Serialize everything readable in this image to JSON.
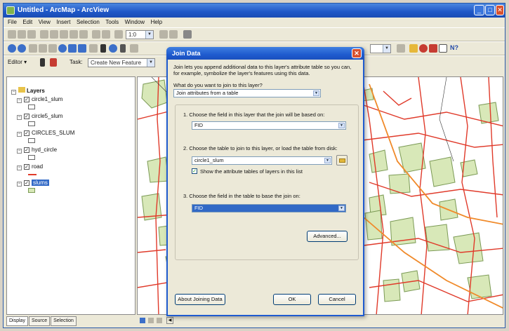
{
  "window": {
    "title": "Untitled - ArcMap - ArcView"
  },
  "menu": [
    "File",
    "Edit",
    "View",
    "Insert",
    "Selection",
    "Tools",
    "Window",
    "Help"
  ],
  "toolbar": {
    "scale_value": "1:0",
    "editor_label": "Editor ▾",
    "task_label": "Task:",
    "task_value": "Create New Feature"
  },
  "toc": {
    "root": "Layers",
    "layers": [
      {
        "name": "circle1_slum",
        "checked": true
      },
      {
        "name": "circle5_slum",
        "checked": true
      },
      {
        "name": "CIRCLES_SLUM",
        "checked": true
      },
      {
        "name": "hyd_circle",
        "checked": true
      },
      {
        "name": "road",
        "checked": true
      },
      {
        "name": "slums",
        "checked": true,
        "selected": true
      }
    ],
    "tabs": [
      "Display",
      "Source",
      "Selection"
    ]
  },
  "dialog": {
    "title": "Join Data",
    "intro": "Join lets you append additional data to this layer's attribute table so you can, for example, symbolize the layer's features using this data.",
    "question": "What do you want to join to this layer?",
    "join_type": "Join attributes from a table",
    "step1_label": "1.  Choose the field in this layer that the join will be based on:",
    "step1_value": "FID",
    "step2_label": "2.  Choose the table to join to this layer, or load the table from disk:",
    "step2_value": "circle1_slum",
    "show_tables_label": "Show the attribute tables of layers in this list",
    "show_tables_checked": true,
    "step3_label": "3.  Choose the field in the table to base the join on:",
    "step3_value": "FID",
    "advanced_button": "Advanced...",
    "about_button": "About Joining Data",
    "ok_button": "OK",
    "cancel_button": "Cancel"
  },
  "colors": {
    "title_blue": "#1f57c7",
    "polygon_fill": "#d8e8b8",
    "polygon_stroke": "#7b9a55",
    "road": "#e03a2a",
    "highlight": "#3169c6"
  }
}
